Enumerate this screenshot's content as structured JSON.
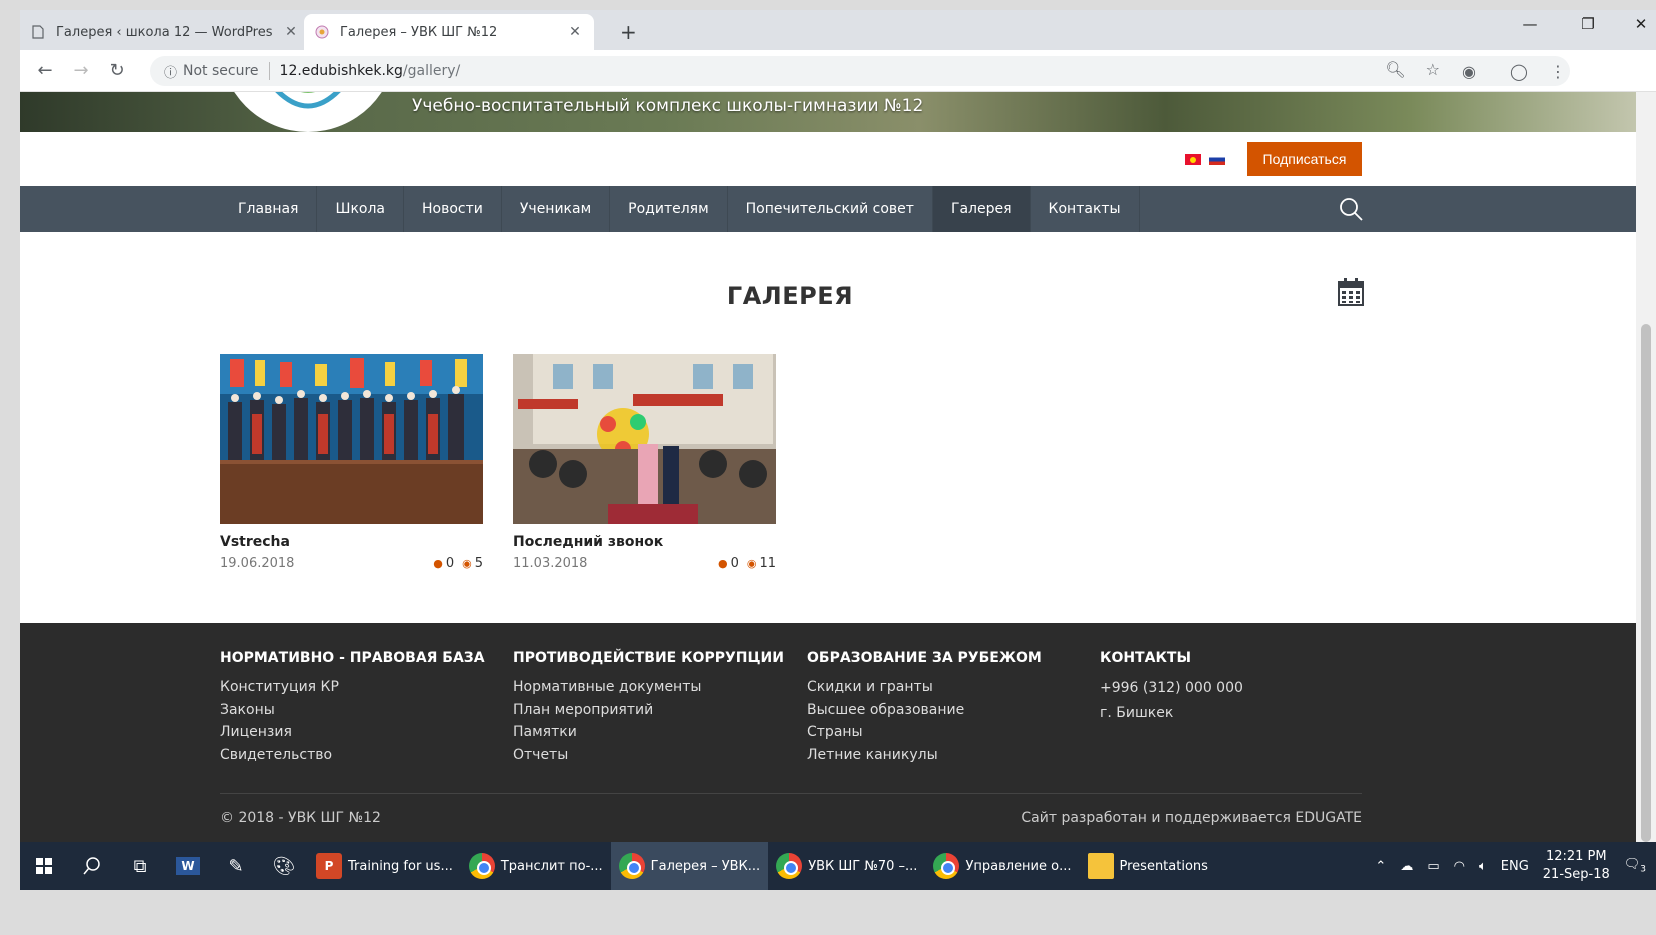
{
  "browser": {
    "tabs": [
      {
        "title": "Галерея ‹ школа 12 — WordPres",
        "active": false
      },
      {
        "title": "Галерея – УВК ШГ №12",
        "active": true
      }
    ],
    "url": {
      "security": "Not secure",
      "host": "12.edubishkek.kg",
      "path": "/gallery/"
    }
  },
  "site": {
    "tagline": "Учебно-воспитательный комплекс школы-гимназии №12",
    "subscribe_label": "Подписаться",
    "nav": [
      {
        "label": "Главная",
        "active": false
      },
      {
        "label": "Школа",
        "active": false
      },
      {
        "label": "Новости",
        "active": false
      },
      {
        "label": "Ученикам",
        "active": false
      },
      {
        "label": "Родителям",
        "active": false
      },
      {
        "label": "Попечительский совет",
        "active": false
      },
      {
        "label": "Галерея",
        "active": true
      },
      {
        "label": "Контакты",
        "active": false
      }
    ]
  },
  "gallery": {
    "title": "ГАЛЕРЕЯ",
    "albums": [
      {
        "title": "Vstrecha",
        "date": "19.06.2018",
        "comments": "0",
        "views": "5"
      },
      {
        "title": "Последний звонок",
        "date": "11.03.2018",
        "comments": "0",
        "views": "11"
      }
    ]
  },
  "footer": {
    "columns": [
      {
        "heading": "НОРМАТИВНО - ПРАВОВАЯ БАЗА",
        "links": [
          "Конституция КР",
          "Законы",
          "Лицензия",
          "Свидетельство"
        ]
      },
      {
        "heading": "ПРОТИВОДЕЙСТВИЕ КОРРУПЦИИ",
        "links": [
          "Нормативные документы",
          "План мероприятий",
          "Памятки",
          "Отчеты"
        ]
      },
      {
        "heading": "ОБРАЗОВАНИЕ ЗА РУБЕЖОМ",
        "links": [
          "Скидки и гранты",
          "Высшее образование",
          "Страны",
          "Летние каникулы"
        ]
      },
      {
        "heading": "КОНТАКТЫ",
        "links": [
          "+996 (312) 000 000",
          "г. Бишкек"
        ]
      }
    ],
    "copyright": "© 2018 - УВК ШГ №12",
    "credits": "Сайт разработан и поддерживается EDUGATE"
  },
  "taskbar": {
    "apps": [
      {
        "label": "Training for us...",
        "icon": "powerpoint-icon",
        "active": false
      },
      {
        "label": "Транслит по-...",
        "icon": "chrome-icon",
        "active": false
      },
      {
        "label": "Галерея – УВК...",
        "icon": "chrome-icon",
        "active": true
      },
      {
        "label": "УВК ШГ №70 –...",
        "icon": "chrome-icon",
        "active": false
      },
      {
        "label": "Управление о...",
        "icon": "chrome-icon",
        "active": false
      },
      {
        "label": "Presentations",
        "icon": "folder-icon",
        "active": false
      }
    ],
    "language": "ENG",
    "time": "12:21 PM",
    "date": "21-Sep-18",
    "notification_count": "3"
  },
  "colors": {
    "accent": "#d35400",
    "nav": "#47535f",
    "footer": "#2c2c2c"
  }
}
